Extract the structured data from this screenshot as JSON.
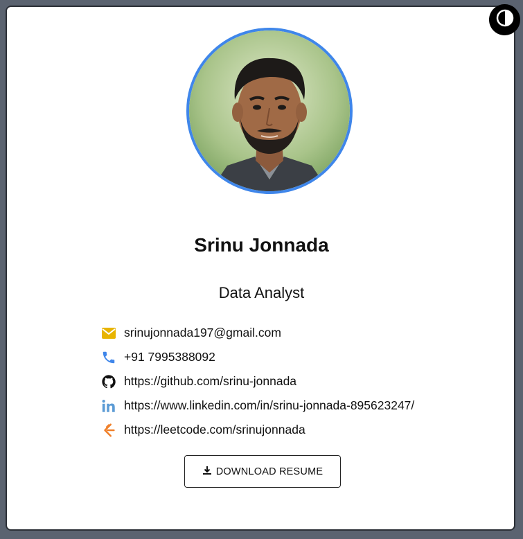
{
  "profile": {
    "name": "Srinu Jonnada",
    "role": "Data Analyst"
  },
  "contacts": [
    {
      "icon": "email-icon",
      "value": "srinujonnada197@gmail.com",
      "color": "#e8b400"
    },
    {
      "icon": "phone-icon",
      "value": "+91 7995388092",
      "color": "#3f86ea"
    },
    {
      "icon": "github-icon",
      "value": "https://github.com/srinu-jonnada",
      "color": "#111111"
    },
    {
      "icon": "linkedin-icon",
      "value": "https://www.linkedin.com/in/srinu-jonnada-895623247/",
      "color": "#5b9bd5"
    },
    {
      "icon": "leetcode-icon",
      "value": "https://leetcode.com/srinujonnada",
      "color": "#f0802a"
    }
  ],
  "actions": {
    "download_label": "DOWNLOAD RESUME"
  },
  "colors": {
    "accent": "#3f86ea",
    "background": "#5b6370",
    "card": "#ffffff"
  }
}
